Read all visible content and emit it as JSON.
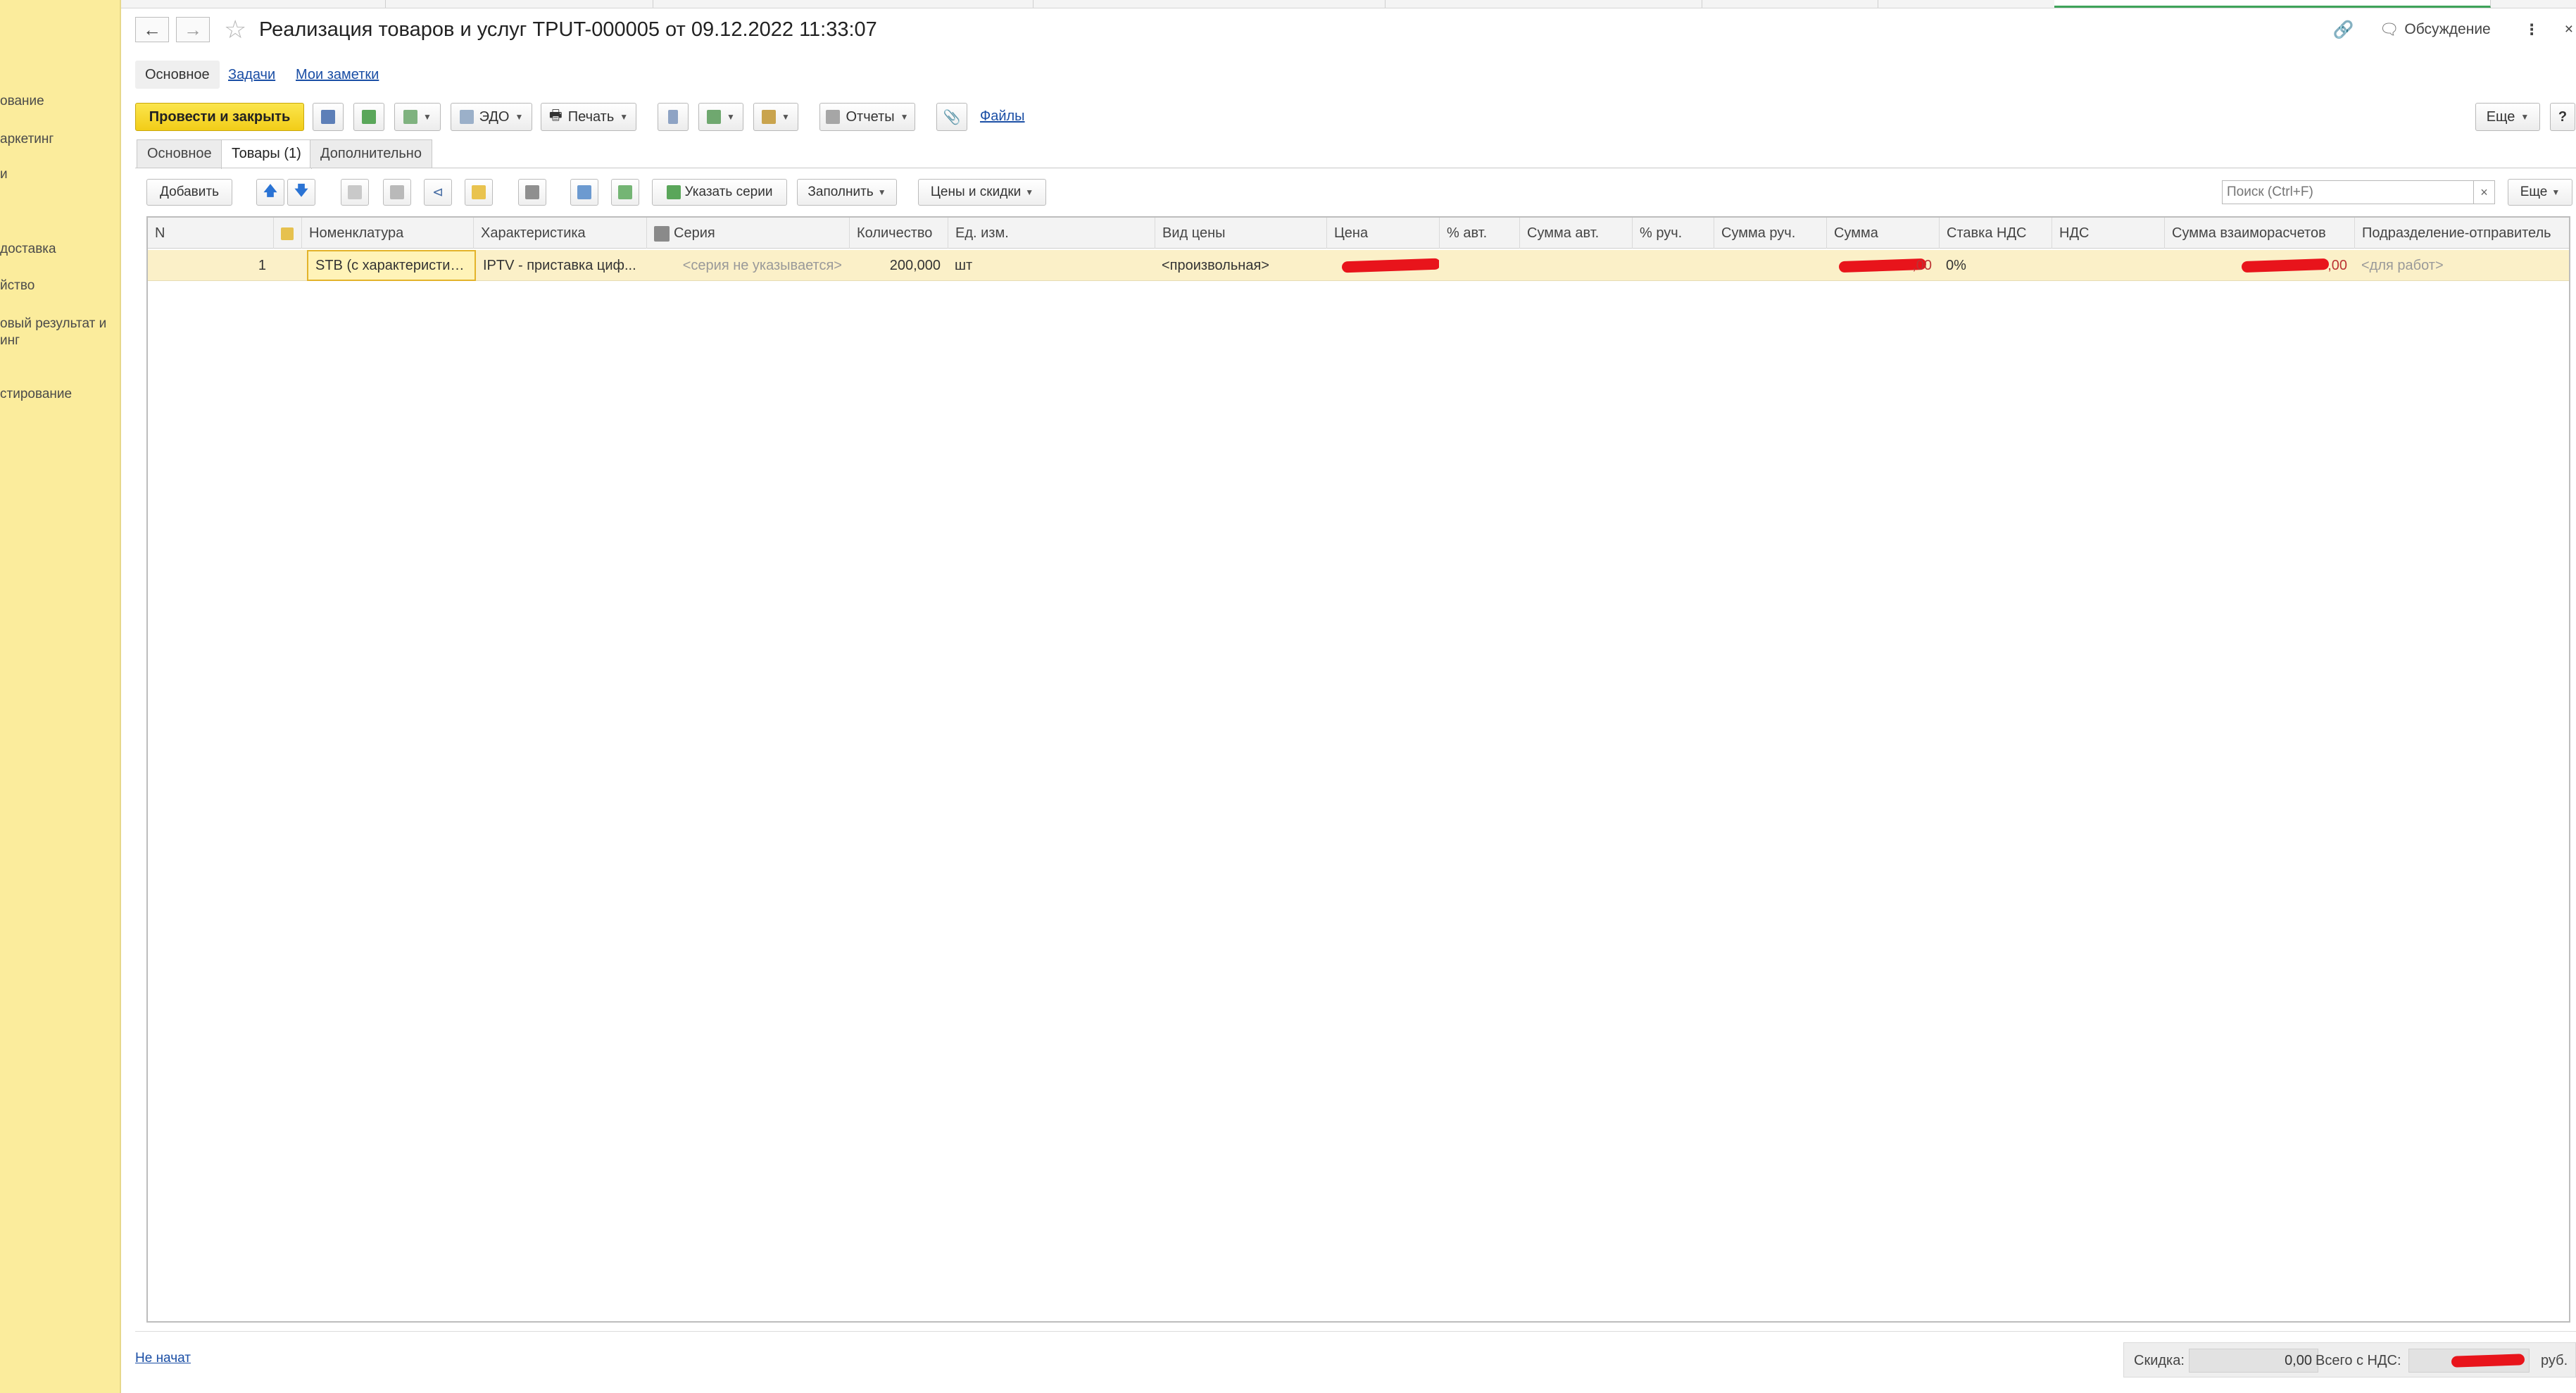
{
  "sidebar": {
    "items": [
      {
        "label": "ование"
      },
      {
        "label": "аркетинг"
      },
      {
        "label": "и"
      },
      {
        "label": "доставка"
      },
      {
        "label": "йство"
      },
      {
        "label": "овый результат и"
      },
      {
        "label": "инг"
      },
      {
        "label": "стирование"
      }
    ]
  },
  "header": {
    "title": "Реализация товаров и услуг TPUT-000005 от 09.12.2022 11:33:07",
    "discussion_label": "Обсуждение",
    "back_icon": "arrow-left-icon",
    "forward_icon": "arrow-right-icon"
  },
  "sections": {
    "main": "Основное",
    "tasks": "Задачи",
    "notes": "Мои заметки"
  },
  "commandbar": {
    "post_close": "Провести и закрыть",
    "edo": "ЭДО",
    "print": "Печать",
    "reports": "Отчеты",
    "files": "Файлы",
    "more": "Еще",
    "help": "?"
  },
  "tabs": [
    {
      "label": "Основное"
    },
    {
      "label": "Товары (1)"
    },
    {
      "label": "Дополнительно"
    }
  ],
  "table_toolbar": {
    "add": "Добавить",
    "specify_series": "Указать серии",
    "fill": "Заполнить",
    "prices_discounts": "Цены и скидки",
    "search_placeholder": "Поиск (Ctrl+F)",
    "more": "Еще"
  },
  "table": {
    "columns": [
      "N",
      "",
      "Номенклатура",
      "Характеристика",
      "Серия",
      "Количество",
      "Ед. изм.",
      "Вид цены",
      "Цена",
      "% авт.",
      "Сумма авт.",
      "% руч.",
      "Сумма руч.",
      "Сумма",
      "Ставка НДС",
      "НДС",
      "Сумма взаиморасчетов",
      "Подразделение-отправитель"
    ],
    "rows": [
      {
        "n": "1",
        "nomenclature": "STB (с характеристик...",
        "characteristic": "IPTV - приставка циф...",
        "series": "<серия не указывается>",
        "quantity": "200,000",
        "unit": "шт",
        "price_type": "<произвольная>",
        "vat_rate": "0%",
        "sum_suffix": ",00",
        "settlement_suffix": ",00",
        "department": "<для работ>"
      }
    ]
  },
  "footer": {
    "status": "Не начат",
    "discount_label": "Скидка:",
    "discount_value": "0,00",
    "total_label": "Всего с НДС:",
    "currency": "руб."
  },
  "colors": {
    "sidebar": "#fbec9c",
    "primary_button": "#f2cd18",
    "selected_row": "#fbf0c8",
    "link": "#1a4ea5",
    "redaction": "#e8141b"
  }
}
